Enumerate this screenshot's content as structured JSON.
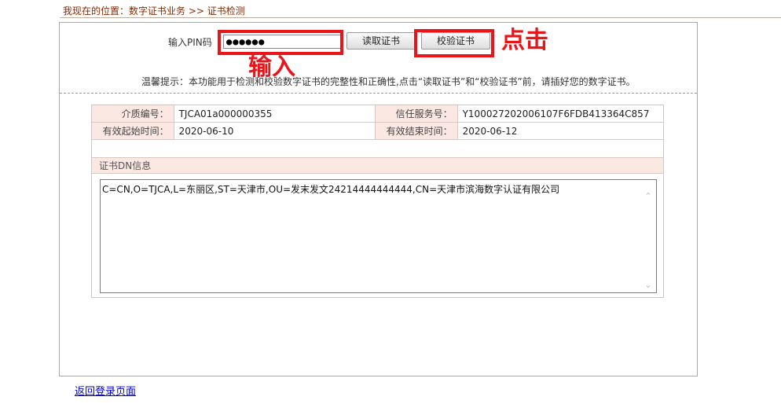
{
  "breadcrumb": {
    "prefix": "我现在的位置：",
    "section": "数字证书业务",
    "separator": ">>",
    "current": "证书检测"
  },
  "form": {
    "pin_label": "输入PIN码",
    "pin_value": "●●●●●●",
    "read_button": "读取证书",
    "verify_button": "校验证书",
    "tip": "温馨提示：本功能用于检测和校验数字证书的完整性和正确性,点击“读取证书”和“校验证书”前，请插好您的数字证书。"
  },
  "annotations": {
    "input_note": "输入",
    "click_note": "点击",
    "highlight_color": "#e8151b"
  },
  "cert_info": {
    "rows": [
      {
        "label1": "介质编号：",
        "value1": "TJCA01a000000355",
        "label2": "信任服务号：",
        "value2": "Y100027202006107F6FDB413364C857"
      },
      {
        "label1": "有效起始时间：",
        "value1": "2020-06-10",
        "label2": "有效结束时间：",
        "value2": "2020-06-12"
      }
    ],
    "dn_header": "证书DN信息",
    "dn_value": "C=CN,O=TJCA,L=东丽区,ST=天津市,OU=发末发文24214444444444,CN=天津市滨海数字认证有限公司"
  },
  "footer": {
    "back_link": "返回登录页面"
  }
}
